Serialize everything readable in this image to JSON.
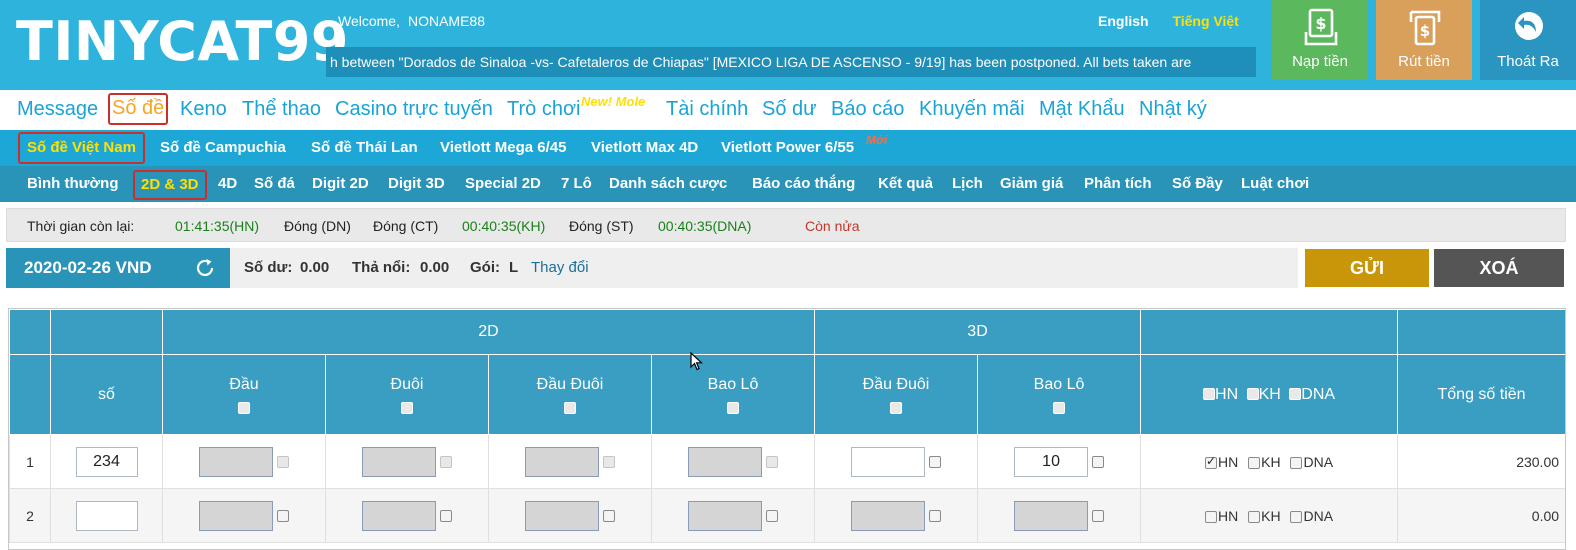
{
  "header": {
    "logo": "TINYCAT99",
    "welcome_label": "Welcome,",
    "username": "NONAME88",
    "lang_english": "English",
    "lang_vietnamese": "Tiếng Việt",
    "ticker_text": "h between \"Dorados de Sinaloa -vs- Cafetaleros de Chiapas\" [MEXICO LIGA DE ASCENSO - 9/19] has been postponed. All bets taken are",
    "deposit_label": "Nạp tiền",
    "withdraw_label": "Rút tiền",
    "logout_label": "Thoát Ra"
  },
  "main_nav": {
    "items": [
      "Message",
      "Số đề",
      "Keno",
      "Thể thao",
      "Casino trực tuyến",
      "Trò chơi",
      "Tài chính",
      "Số dư",
      "Báo cáo",
      "Khuyến mãi",
      "Mật Khẩu",
      "Nhật ký"
    ],
    "active": "Số đề",
    "new_tag": "New! Mole"
  },
  "sub_nav": {
    "items": [
      "Số đề Việt Nam",
      "Số đề Campuchia",
      "Số đề Thái Lan",
      "Vietlott Mega 6/45",
      "Vietlott Max 4D",
      "Vietlott Power 6/55"
    ],
    "active": "Số đề Việt Nam",
    "new_tag": "Mới"
  },
  "tab_nav": {
    "items": [
      "Bình thường",
      "2D & 3D",
      "4D",
      "Số đá",
      "Digit 2D",
      "Digit 3D",
      "Special 2D",
      "7 Lô",
      "Danh sách cược",
      "Báo cáo thắng",
      "Kết quả",
      "Lịch",
      "Giảm giá",
      "Phân tích",
      "Số Đầy",
      "Luật chơi"
    ],
    "active": "2D & 3D"
  },
  "time_bar": {
    "label": "Thời gian còn lại:",
    "hn": "01:41:35(HN)",
    "dn": "Đóng (DN)",
    "ct": "Đóng (CT)",
    "kh": "00:40:35(KH)",
    "st": "Đóng (ST)",
    "dna": "00:40:35(DNA)",
    "more": "Còn nửa"
  },
  "balance_bar": {
    "date": "2020-02-26 VND",
    "balance_label": "Số dư:",
    "balance_value": "0.00",
    "float_label": "Thả nổi:",
    "float_value": "0.00",
    "package_label": "Gói:",
    "package_value": "L",
    "change_link": "Thay đổi",
    "send_button": "GỬI",
    "clear_button": "XOÁ"
  },
  "table": {
    "group_2d": "2D",
    "group_3d": "3D",
    "col_so": "số",
    "col_dau": "Đầu",
    "col_duoi": "Đuôi",
    "col_dau_duoi_2d": "Đầu Đuôi",
    "col_bao_lo_2d": "Bao Lô",
    "col_dau_duoi_3d": "Đầu Đuôi",
    "col_bao_lo_3d": "Bao Lô",
    "region_hn": "HN",
    "region_kh": "KH",
    "region_dna": "DNA",
    "col_total": "Tổng số tiền",
    "rows": [
      {
        "index": "1",
        "number": "234",
        "bao_lo_3d": "10",
        "hn_checked": true,
        "total": "230.00"
      },
      {
        "index": "2",
        "number": "",
        "bao_lo_3d": "",
        "hn_checked": false,
        "total": "0.00"
      }
    ]
  },
  "colors": {
    "header_bg": "#2eb4dc",
    "deposit": "#5cb85c",
    "withdraw": "#d9a05b",
    "logout": "#2a95c0",
    "send": "#c9960a",
    "clear": "#555555",
    "active_highlight": "#ffe000",
    "active_border": "#c9302c"
  }
}
